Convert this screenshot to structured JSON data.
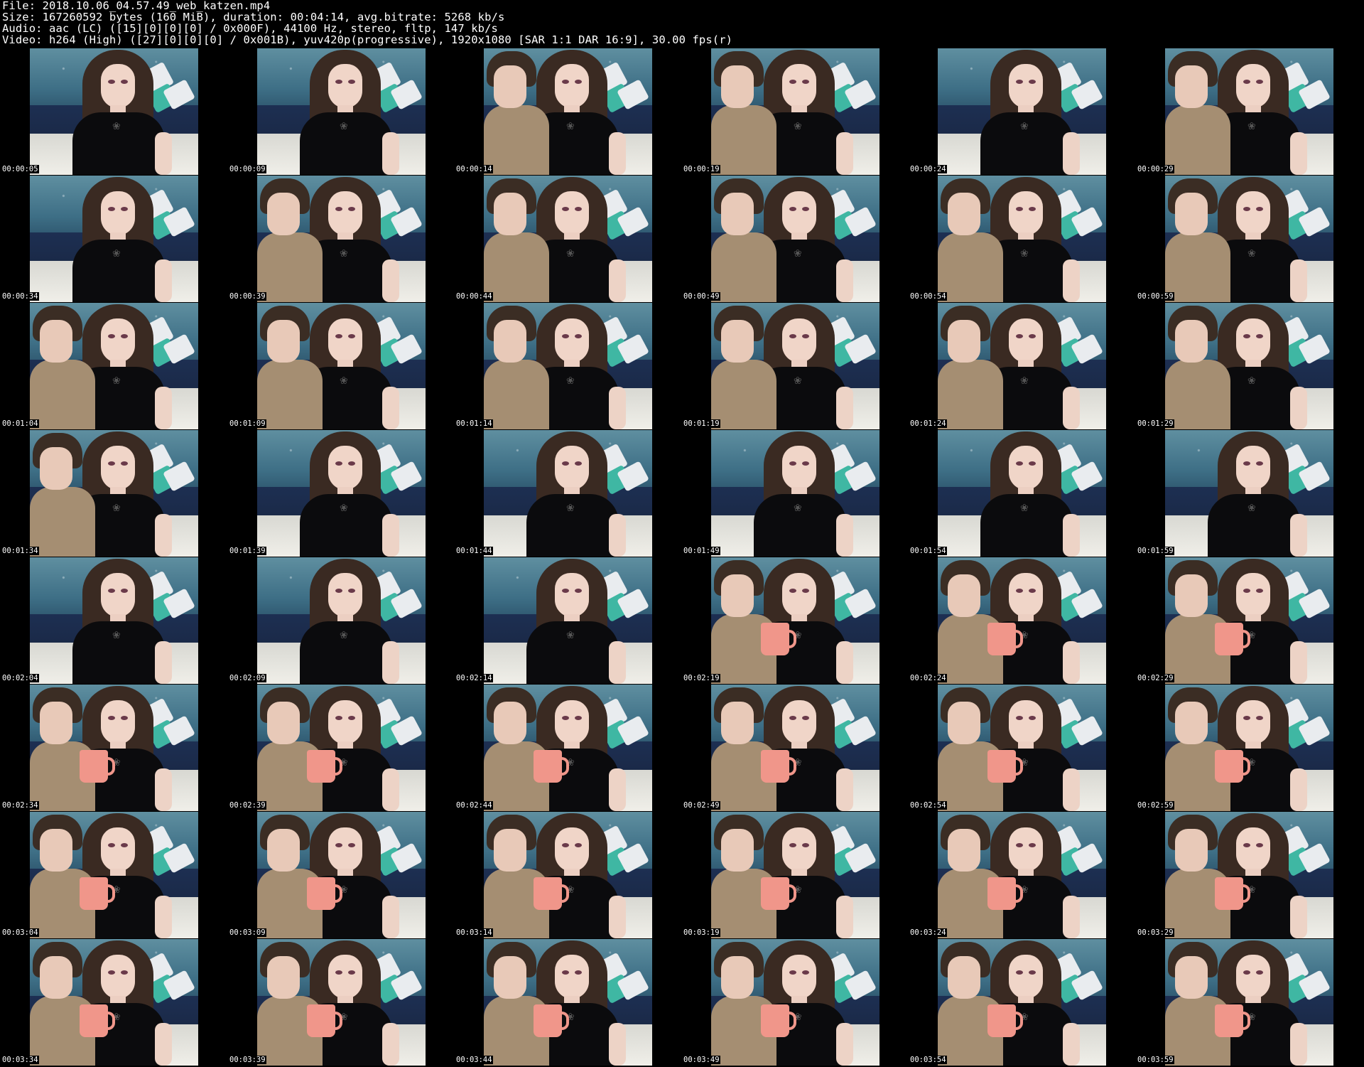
{
  "header": {
    "file_line": "File: 2018.10.06_04.57.49_web_katzen.mp4",
    "size_line": "Size: 167260592 bytes (160 MiB), duration: 00:04:14, avg.bitrate: 5268 kb/s",
    "audio_line": "Audio: aac (LC) ([15][0][0][0] / 0x000F), 44100 Hz, stereo, fltp, 147 kb/s",
    "video_line": "Video: h264 (High) ([27][0][0][0] / 0x001B), yuv420p(progressive), 1920x1080 [SAR 1:1 DAR 16:9], 30.00 fps(r)"
  },
  "thumbnails": [
    {
      "time": "00:00:05",
      "companion": false,
      "mug": false
    },
    {
      "time": "00:00:09",
      "companion": false,
      "mug": false
    },
    {
      "time": "00:00:14",
      "companion": true,
      "mug": false
    },
    {
      "time": "00:00:19",
      "companion": true,
      "mug": false
    },
    {
      "time": "00:00:24",
      "companion": false,
      "mug": false
    },
    {
      "time": "00:00:29",
      "companion": true,
      "mug": false
    },
    {
      "time": "00:00:34",
      "companion": false,
      "mug": false
    },
    {
      "time": "00:00:39",
      "companion": true,
      "mug": false
    },
    {
      "time": "00:00:44",
      "companion": true,
      "mug": false
    },
    {
      "time": "00:00:49",
      "companion": true,
      "mug": false
    },
    {
      "time": "00:00:54",
      "companion": true,
      "mug": false
    },
    {
      "time": "00:00:59",
      "companion": true,
      "mug": false
    },
    {
      "time": "00:01:04",
      "companion": true,
      "mug": false
    },
    {
      "time": "00:01:09",
      "companion": true,
      "mug": false
    },
    {
      "time": "00:01:14",
      "companion": true,
      "mug": false
    },
    {
      "time": "00:01:19",
      "companion": true,
      "mug": false
    },
    {
      "time": "00:01:24",
      "companion": true,
      "mug": false
    },
    {
      "time": "00:01:29",
      "companion": true,
      "mug": false
    },
    {
      "time": "00:01:34",
      "companion": true,
      "mug": false
    },
    {
      "time": "00:01:39",
      "companion": false,
      "mug": false
    },
    {
      "time": "00:01:44",
      "companion": false,
      "mug": false
    },
    {
      "time": "00:01:49",
      "companion": false,
      "mug": false
    },
    {
      "time": "00:01:54",
      "companion": false,
      "mug": false
    },
    {
      "time": "00:01:59",
      "companion": false,
      "mug": false
    },
    {
      "time": "00:02:04",
      "companion": false,
      "mug": false
    },
    {
      "time": "00:02:09",
      "companion": false,
      "mug": false
    },
    {
      "time": "00:02:14",
      "companion": false,
      "mug": false
    },
    {
      "time": "00:02:19",
      "companion": true,
      "mug": true
    },
    {
      "time": "00:02:24",
      "companion": true,
      "mug": true
    },
    {
      "time": "00:02:29",
      "companion": true,
      "mug": true
    },
    {
      "time": "00:02:34",
      "companion": true,
      "mug": true
    },
    {
      "time": "00:02:39",
      "companion": true,
      "mug": true
    },
    {
      "time": "00:02:44",
      "companion": true,
      "mug": true
    },
    {
      "time": "00:02:49",
      "companion": true,
      "mug": true
    },
    {
      "time": "00:02:54",
      "companion": true,
      "mug": true
    },
    {
      "time": "00:02:59",
      "companion": true,
      "mug": true
    },
    {
      "time": "00:03:04",
      "companion": true,
      "mug": true
    },
    {
      "time": "00:03:09",
      "companion": true,
      "mug": true
    },
    {
      "time": "00:03:14",
      "companion": true,
      "mug": true
    },
    {
      "time": "00:03:19",
      "companion": true,
      "mug": true
    },
    {
      "time": "00:03:24",
      "companion": true,
      "mug": true
    },
    {
      "time": "00:03:29",
      "companion": true,
      "mug": true
    },
    {
      "time": "00:03:34",
      "companion": true,
      "mug": true
    },
    {
      "time": "00:03:39",
      "companion": true,
      "mug": true
    },
    {
      "time": "00:03:44",
      "companion": true,
      "mug": true
    },
    {
      "time": "00:03:49",
      "companion": true,
      "mug": true
    },
    {
      "time": "00:03:54",
      "companion": true,
      "mug": true
    },
    {
      "time": "00:03:59",
      "companion": true,
      "mug": true
    }
  ],
  "colors": {
    "background": "#000000",
    "text": "#ffffff",
    "mug": "#f0968a",
    "shirt": "#0b0b0d",
    "hoodie": "#a58e72"
  }
}
